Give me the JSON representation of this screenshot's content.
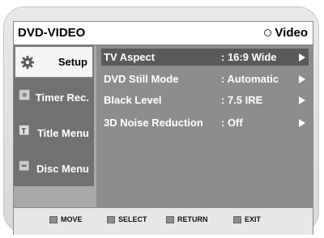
{
  "header": {
    "title": "DVD-VIDEO",
    "mode": "Video"
  },
  "sidebar": {
    "items": [
      {
        "label": "Setup",
        "icon": "gear-icon",
        "active": true
      },
      {
        "label": "Timer Rec.",
        "icon": "timer-icon",
        "active": false
      },
      {
        "label": "Title Menu",
        "icon": "title-menu-icon",
        "active": false
      },
      {
        "label": "Disc Menu",
        "icon": "disc-menu-icon",
        "active": false
      }
    ]
  },
  "settings": [
    {
      "label": "TV Aspect",
      "value": ": 16:9 Wide",
      "active": true
    },
    {
      "label": "DVD Still Mode",
      "value": ": Automatic",
      "active": false
    },
    {
      "label": "Black Level",
      "value": ": 7.5 IRE",
      "active": false
    },
    {
      "label": "3D Noise Reduction",
      "value": ": Off",
      "active": false
    }
  ],
  "footer": {
    "move": "MOVE",
    "select": "SELECT",
    "return": "RETURN",
    "exit": "EXIT"
  },
  "colors": {
    "highlight": "#5a5a5a",
    "panel": "#8d8d8d",
    "sidebar": "#717171"
  }
}
